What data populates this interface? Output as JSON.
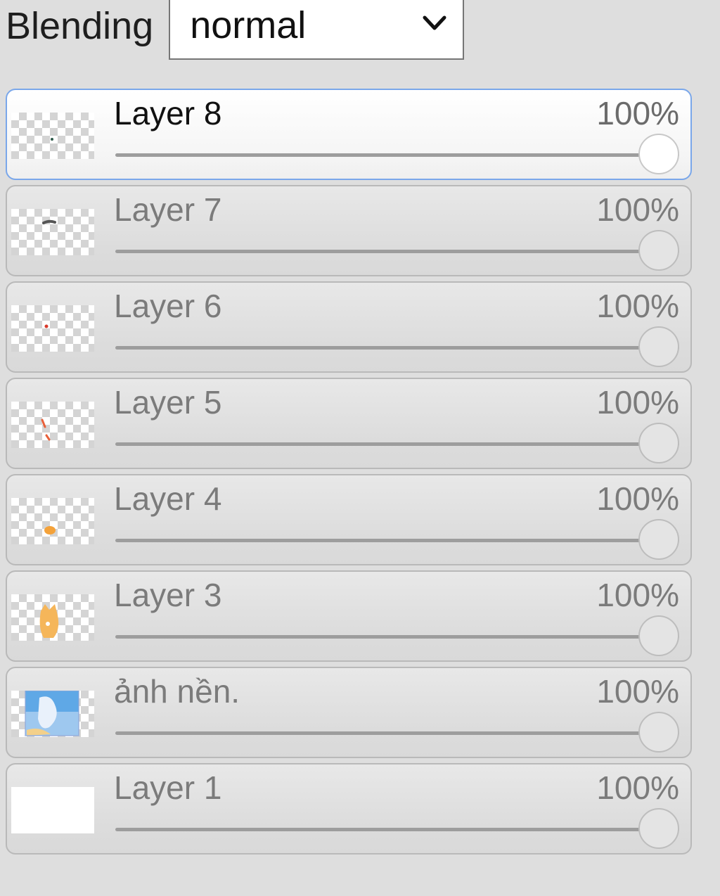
{
  "blending": {
    "label": "Blending",
    "selected": "normal"
  },
  "layers": [
    {
      "name": "Layer 8",
      "opacity_label": "100%",
      "opacity": 1.0,
      "active": true,
      "thumb": "dot-dark"
    },
    {
      "name": "Layer 7",
      "opacity_label": "100%",
      "opacity": 1.0,
      "active": false,
      "thumb": "stroke-gray"
    },
    {
      "name": "Layer 6",
      "opacity_label": "100%",
      "opacity": 1.0,
      "active": false,
      "thumb": "dot-red"
    },
    {
      "name": "Layer 5",
      "opacity_label": "100%",
      "opacity": 1.0,
      "active": false,
      "thumb": "marks-orange"
    },
    {
      "name": "Layer 4",
      "opacity_label": "100%",
      "opacity": 1.0,
      "active": false,
      "thumb": "blob-orange"
    },
    {
      "name": "Layer 3",
      "opacity_label": "100%",
      "opacity": 1.0,
      "active": false,
      "thumb": "figure-orange"
    },
    {
      "name": "ảnh nền.",
      "opacity_label": "100%",
      "opacity": 1.0,
      "active": false,
      "thumb": "image-blue"
    },
    {
      "name": "Layer 1",
      "opacity_label": "100%",
      "opacity": 1.0,
      "active": false,
      "thumb": "white"
    }
  ],
  "colors": {
    "active_border": "#7aa7ea",
    "panel_bg": "#dedede"
  }
}
